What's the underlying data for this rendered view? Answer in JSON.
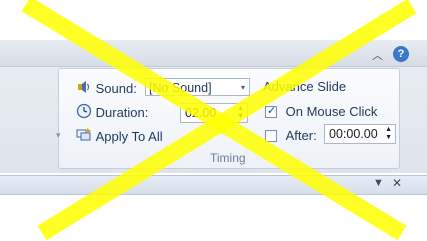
{
  "window": {
    "help_label": "?",
    "collapse_ribbon_icon": "chevron-up-icon",
    "pane_dropdown_icon": "triangle-down-icon",
    "pane_close_label": "✕"
  },
  "timing_group": {
    "label": "Timing",
    "sound_label": "Sound:",
    "sound_value": "[No Sound]",
    "duration_label": "Duration:",
    "duration_value": "02.00",
    "apply_to_all_label": "Apply To All",
    "advance_slide_label": "Advance Slide",
    "on_mouse_click_label": "On Mouse Click",
    "on_mouse_click_checked": true,
    "after_label": "After:",
    "after_checked": false,
    "after_value": "00:00.00"
  },
  "colors": {
    "overlay_x": "#ffff00",
    "accent_text": "#1e395b",
    "group_label": "#6a7f99"
  }
}
